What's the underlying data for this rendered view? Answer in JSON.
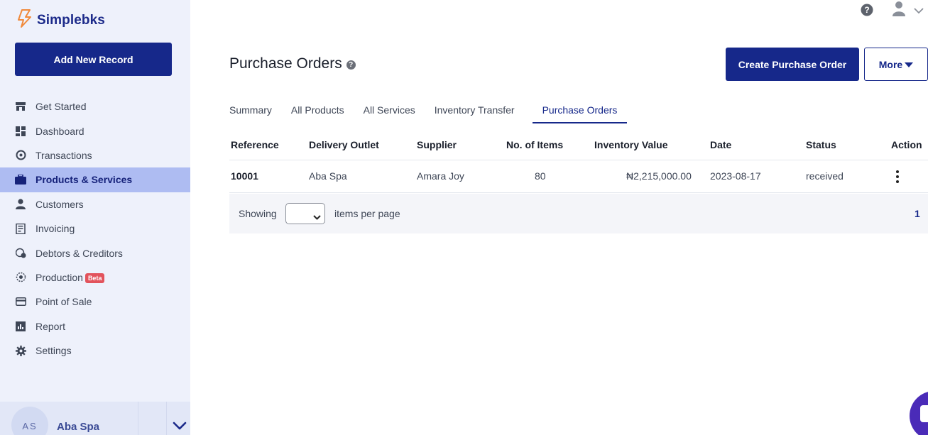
{
  "brand": {
    "name": "Simplebks"
  },
  "sidebar": {
    "add_button": "Add New Record",
    "items": [
      {
        "label": "Get Started",
        "icon": "store-icon"
      },
      {
        "label": "Dashboard",
        "icon": "dashboard-icon"
      },
      {
        "label": "Transactions",
        "icon": "transactions-icon"
      },
      {
        "label": "Products & Services",
        "icon": "briefcase-icon",
        "active": true
      },
      {
        "label": "Customers",
        "icon": "user-icon"
      },
      {
        "label": "Invoicing",
        "icon": "invoice-icon"
      },
      {
        "label": "Debtors & Creditors",
        "icon": "debtors-icon"
      },
      {
        "label": "Production",
        "icon": "production-icon",
        "badge": "Beta"
      },
      {
        "label": "Point of Sale",
        "icon": "card-icon"
      },
      {
        "label": "Report",
        "icon": "report-icon"
      },
      {
        "label": "Settings",
        "icon": "gear-icon"
      }
    ],
    "footer": {
      "initials": "AS",
      "outlet": "Aba Spa"
    }
  },
  "header": {
    "title": "Purchase Orders",
    "title_help": "?",
    "create_button": "Create Purchase Order",
    "more_button": "More"
  },
  "tabs": [
    {
      "label": "Summary"
    },
    {
      "label": "All Products"
    },
    {
      "label": "All Services"
    },
    {
      "label": "Inventory Transfer"
    },
    {
      "label": "Purchase Orders",
      "active": true
    }
  ],
  "table": {
    "columns": [
      "Reference",
      "Delivery Outlet",
      "Supplier",
      "No. of Items",
      "Inventory Value",
      "Date",
      "Status",
      "Action"
    ],
    "rows": [
      {
        "reference": "10001",
        "outlet": "Aba Spa",
        "supplier": "Amara Joy",
        "items": "80",
        "value": "₦2,215,000.00",
        "date": "2023-08-17",
        "status": "received"
      }
    ]
  },
  "pager": {
    "showing": "Showing",
    "items_per_page": "items per page",
    "page": "1"
  },
  "colors": {
    "primary": "#16288a",
    "sidebar_bg": "#eef1fb",
    "active_bg": "#aebcf2",
    "beta": "#e2535c",
    "brand_icon": "#f08a3c"
  }
}
